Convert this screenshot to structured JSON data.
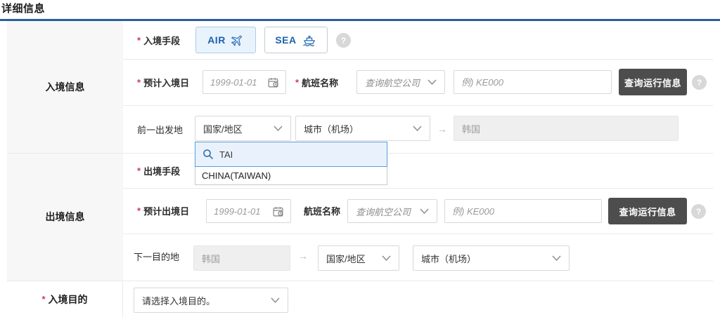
{
  "ui": {
    "required_mark": "*",
    "arrow": "→",
    "help": "?",
    "accent_color": "#2a5d9f",
    "toggle_text_color": "#1b63ae",
    "selected_toggle_bg": "#e9f3fc",
    "dark_button_color": "#4d4d4d",
    "required_color": "#cf3a57"
  },
  "page": {
    "title": "详细信息"
  },
  "sidebar": {
    "entry_section": "入境信息",
    "departure_section": "出境信息"
  },
  "entry": {
    "method_label": "入境手段",
    "air_label": "AIR",
    "sea_label": "SEA",
    "date_label": "预计入境日",
    "date_placeholder": "1999-01-01",
    "flight_label": "航班名称",
    "airline_placeholder": "查询航空公司",
    "flight_no_placeholder": "例) KE000",
    "search_button": "查询运行信息",
    "prev_departure_label": "前一出发地",
    "country_placeholder": "国家/地区",
    "city_placeholder": "城市（机场）",
    "arrival_value": "韩国"
  },
  "country_dropdown": {
    "search_value": "TAI",
    "options": [
      "CHINA(TAIWAN)"
    ]
  },
  "departure": {
    "method_label": "出境手段",
    "date_label": "预计出境日",
    "date_placeholder": "1999-01-01",
    "flight_label": "航班名称",
    "airline_placeholder": "查询航空公司",
    "flight_no_placeholder": "例) KE000",
    "search_button": "查询运行信息",
    "next_destination_label": "下一目的地",
    "origin_value": "韩国",
    "country_placeholder": "国家/地区",
    "city_placeholder": "城市（机场）"
  },
  "purpose": {
    "label": "入境目的",
    "select_placeholder": "请选择入境目的。"
  }
}
